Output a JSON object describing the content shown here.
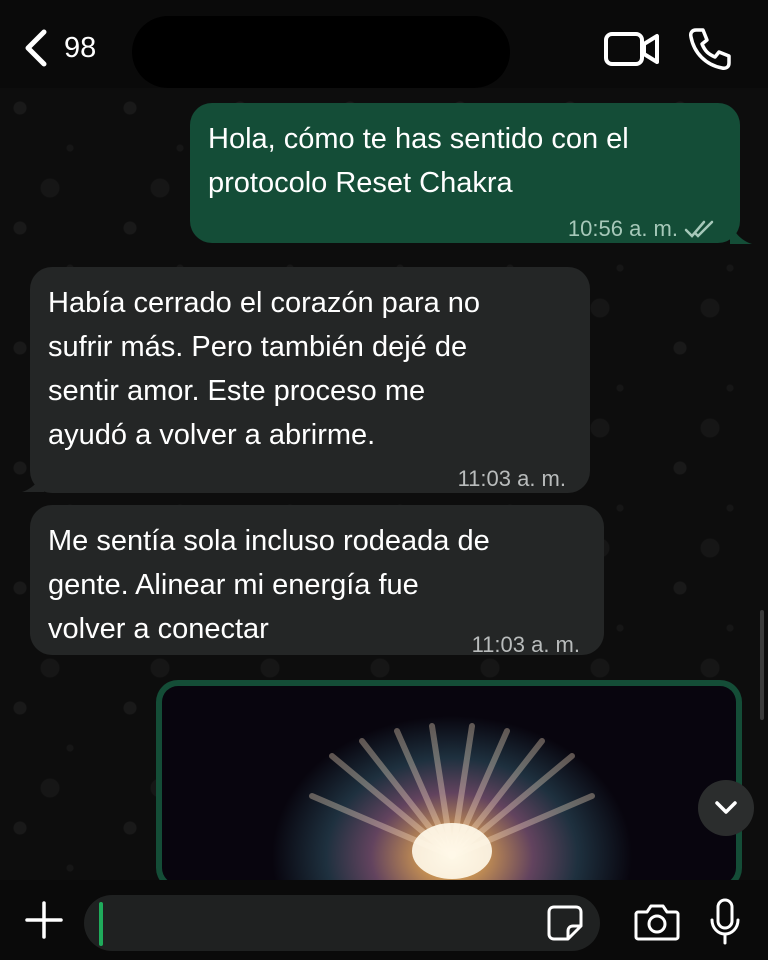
{
  "header": {
    "back_count": "98",
    "icons": {
      "back": "chevron-left-icon",
      "video": "video-camera-icon",
      "call": "phone-icon"
    }
  },
  "messages": [
    {
      "direction": "outgoing",
      "text": "Hola, cómo te has sentido con el\nprotocolo  Reset Chakra",
      "time": "10:56 a. m.",
      "status": "read-double-check"
    },
    {
      "direction": "incoming",
      "text": "Había cerrado el corazón para no\nsufrir más. Pero también dejé de\nsentir amor. Este proceso me\nayudó a volver a abrirme.",
      "time": "11:03 a. m."
    },
    {
      "direction": "incoming",
      "text": "Me sentía sola incluso rodeada de\ngente. Alinear mi energía fue\nvolver a conectar",
      "time": "11:03 a. m."
    },
    {
      "direction": "outgoing",
      "type": "image"
    }
  ],
  "composer": {
    "icons": {
      "attach": "plus-icon",
      "sticker": "sticker-icon",
      "camera": "camera-icon",
      "mic": "microphone-icon"
    },
    "value": ""
  },
  "colors": {
    "outgoing_bubble": "#144d37",
    "incoming_bubble": "#242626",
    "caret": "#1fab5b",
    "background": "#0b0b0b"
  }
}
